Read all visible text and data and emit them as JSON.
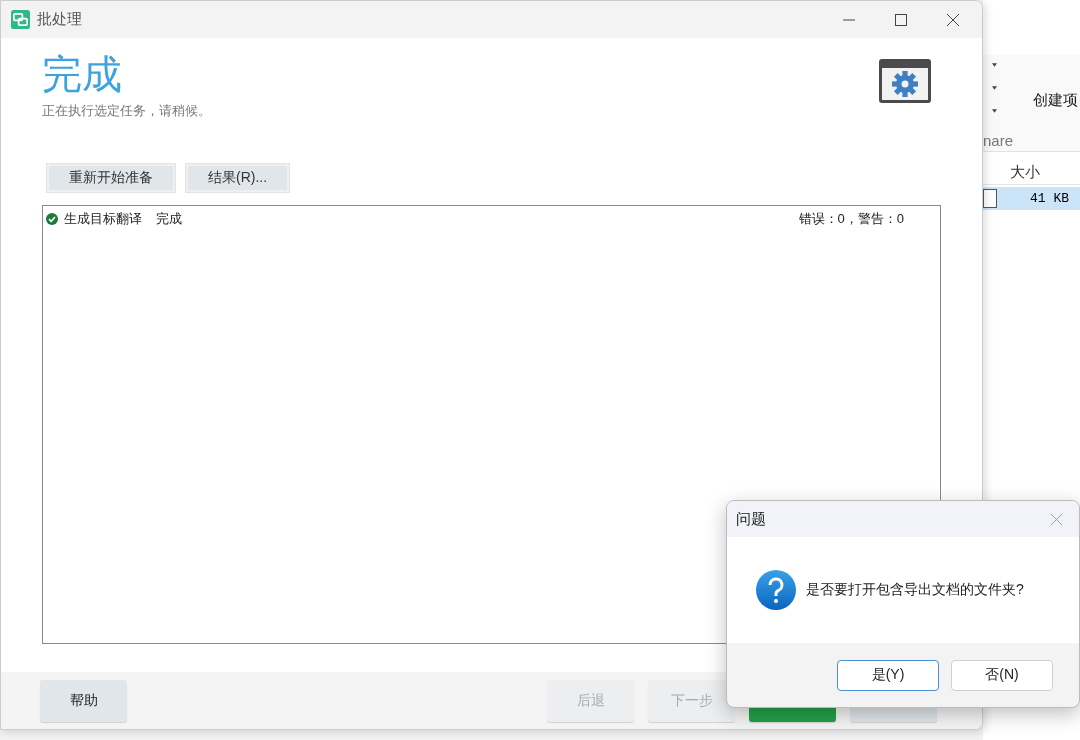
{
  "background_window": {
    "ribbon_label": "创建项",
    "group_label": "nare",
    "columns": [
      "大小"
    ],
    "rows": [
      {
        "size": "41 KB",
        "selected": true
      }
    ]
  },
  "main_window": {
    "title": "批处理",
    "heading": "完成",
    "subtitle": "正在执行选定任务，请稍候。",
    "actions": [
      "重新开始准备",
      "结果(R)..."
    ],
    "tasks": [
      {
        "name": "生成目标翻译",
        "status": "完成",
        "summary": "错误：0，警告：0",
        "done": true
      }
    ],
    "footer_buttons": [
      {
        "label": "帮助",
        "kind": "normal",
        "disabled": false
      },
      {
        "label": "后退",
        "kind": "normal",
        "disabled": true
      },
      {
        "label": "下一步",
        "kind": "normal",
        "disabled": true
      },
      {
        "kind": "primary",
        "disabled": false
      },
      {
        "kind": "normal"
      }
    ]
  },
  "dialog": {
    "title": "问题",
    "message": "是否要打开包含导出文档的文件夹?",
    "buttons": [
      {
        "label": "是(Y)",
        "default": true
      },
      {
        "label": "否(N)",
        "default": false
      }
    ]
  }
}
